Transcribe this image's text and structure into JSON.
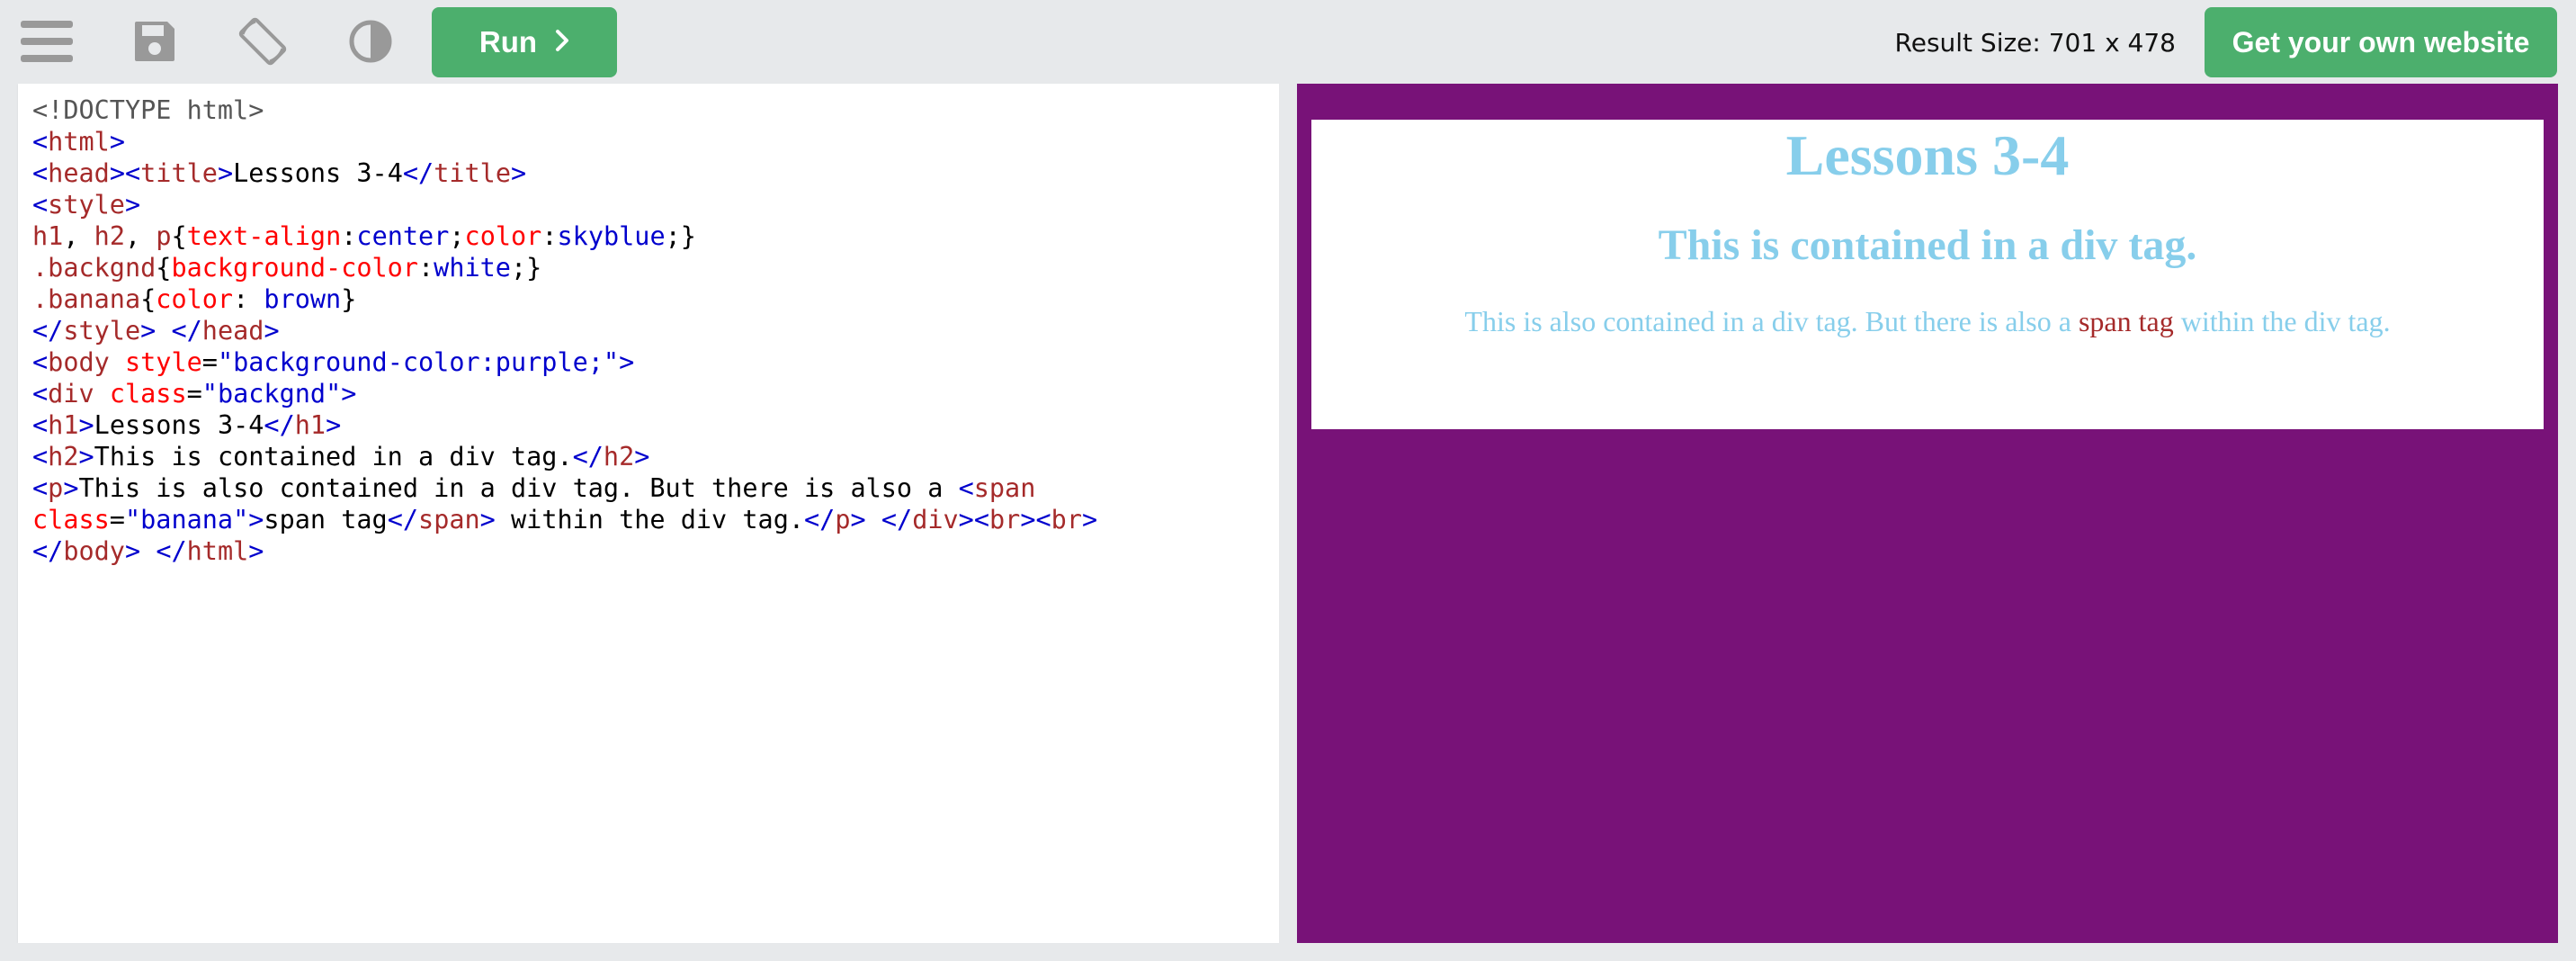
{
  "toolbar": {
    "icons": {
      "menu": "hamburger-menu-icon",
      "save": "save-floppy-icon",
      "rotate": "rotate-orientation-icon",
      "theme": "contrast-theme-icon"
    },
    "run_label": "Run",
    "result_size": "Result Size: 701 x 478",
    "own_website_label": "Get your own website"
  },
  "colors": {
    "accent_green": "#4caf6d",
    "toolbar_bg": "#e7e9eb",
    "result_bg": "#781278"
  },
  "editor": {
    "lines": [
      [
        {
          "t": "doc",
          "v": "<!DOCTYPE html>"
        }
      ],
      [
        {
          "t": "br",
          "v": "<"
        },
        {
          "t": "tag",
          "v": "html"
        },
        {
          "t": "br",
          "v": ">"
        }
      ],
      [
        {
          "t": "br",
          "v": "<"
        },
        {
          "t": "tag",
          "v": "head"
        },
        {
          "t": "br",
          "v": "><"
        },
        {
          "t": "tag",
          "v": "title"
        },
        {
          "t": "br",
          "v": ">"
        },
        {
          "t": "txt",
          "v": "Lessons 3-4"
        },
        {
          "t": "br",
          "v": "</"
        },
        {
          "t": "tag",
          "v": "title"
        },
        {
          "t": "br",
          "v": ">"
        }
      ],
      [
        {
          "t": "br",
          "v": "<"
        },
        {
          "t": "tag",
          "v": "style"
        },
        {
          "t": "br",
          "v": ">"
        }
      ],
      [
        {
          "t": "sel",
          "v": "h1"
        },
        {
          "t": "txt",
          "v": ", "
        },
        {
          "t": "sel",
          "v": "h2"
        },
        {
          "t": "txt",
          "v": ", "
        },
        {
          "t": "sel",
          "v": "p"
        },
        {
          "t": "txt",
          "v": "{"
        },
        {
          "t": "css",
          "v": "text-align"
        },
        {
          "t": "txt",
          "v": ":"
        },
        {
          "t": "val",
          "v": "center"
        },
        {
          "t": "txt",
          "v": ";"
        },
        {
          "t": "css",
          "v": "color"
        },
        {
          "t": "txt",
          "v": ":"
        },
        {
          "t": "val",
          "v": "skyblue"
        },
        {
          "t": "txt",
          "v": ";}"
        }
      ],
      [
        {
          "t": "sel",
          "v": ".backgnd"
        },
        {
          "t": "txt",
          "v": "{"
        },
        {
          "t": "css",
          "v": "background-color"
        },
        {
          "t": "txt",
          "v": ":"
        },
        {
          "t": "val",
          "v": "white"
        },
        {
          "t": "txt",
          "v": ";}"
        }
      ],
      [
        {
          "t": "sel",
          "v": ".banana"
        },
        {
          "t": "txt",
          "v": "{"
        },
        {
          "t": "css",
          "v": "color"
        },
        {
          "t": "txt",
          "v": ": "
        },
        {
          "t": "val",
          "v": "brown"
        },
        {
          "t": "txt",
          "v": "}"
        }
      ],
      [
        {
          "t": "br",
          "v": "</"
        },
        {
          "t": "tag",
          "v": "style"
        },
        {
          "t": "br",
          "v": ">"
        },
        {
          "t": "txt",
          "v": " "
        },
        {
          "t": "br",
          "v": "</"
        },
        {
          "t": "tag",
          "v": "head"
        },
        {
          "t": "br",
          "v": ">"
        }
      ],
      [
        {
          "t": "br",
          "v": "<"
        },
        {
          "t": "tag",
          "v": "body"
        },
        {
          "t": "txt",
          "v": " "
        },
        {
          "t": "attr",
          "v": "style"
        },
        {
          "t": "txt",
          "v": "="
        },
        {
          "t": "val",
          "v": "\"background-color:purple;\""
        },
        {
          "t": "br",
          "v": ">"
        }
      ],
      [
        {
          "t": "br",
          "v": "<"
        },
        {
          "t": "tag",
          "v": "div"
        },
        {
          "t": "txt",
          "v": " "
        },
        {
          "t": "attr",
          "v": "class"
        },
        {
          "t": "txt",
          "v": "="
        },
        {
          "t": "val",
          "v": "\"backgnd\""
        },
        {
          "t": "br",
          "v": ">"
        }
      ],
      [
        {
          "t": "br",
          "v": "<"
        },
        {
          "t": "tag",
          "v": "h1"
        },
        {
          "t": "br",
          "v": ">"
        },
        {
          "t": "txt",
          "v": "Lessons 3-4"
        },
        {
          "t": "br",
          "v": "</"
        },
        {
          "t": "tag",
          "v": "h1"
        },
        {
          "t": "br",
          "v": ">"
        }
      ],
      [
        {
          "t": "br",
          "v": "<"
        },
        {
          "t": "tag",
          "v": "h2"
        },
        {
          "t": "br",
          "v": ">"
        },
        {
          "t": "txt",
          "v": "This is contained in a div tag."
        },
        {
          "t": "br",
          "v": "</"
        },
        {
          "t": "tag",
          "v": "h2"
        },
        {
          "t": "br",
          "v": ">"
        }
      ],
      [
        {
          "t": "br",
          "v": "<"
        },
        {
          "t": "tag",
          "v": "p"
        },
        {
          "t": "br",
          "v": ">"
        },
        {
          "t": "txt",
          "v": "This is also contained in a div tag. But there is also a "
        },
        {
          "t": "br",
          "v": "<"
        },
        {
          "t": "tag",
          "v": "span"
        }
      ],
      [
        {
          "t": "attr",
          "v": "class"
        },
        {
          "t": "txt",
          "v": "="
        },
        {
          "t": "val",
          "v": "\"banana\""
        },
        {
          "t": "br",
          "v": ">"
        },
        {
          "t": "txt",
          "v": "span tag"
        },
        {
          "t": "br",
          "v": "</"
        },
        {
          "t": "tag",
          "v": "span"
        },
        {
          "t": "br",
          "v": ">"
        },
        {
          "t": "txt",
          "v": " within the div tag."
        },
        {
          "t": "br",
          "v": "</"
        },
        {
          "t": "tag",
          "v": "p"
        },
        {
          "t": "br",
          "v": ">"
        },
        {
          "t": "txt",
          "v": " "
        },
        {
          "t": "br",
          "v": "</"
        },
        {
          "t": "tag",
          "v": "div"
        },
        {
          "t": "br",
          "v": "><"
        },
        {
          "t": "tag",
          "v": "br"
        },
        {
          "t": "br",
          "v": "><"
        },
        {
          "t": "tag",
          "v": "br"
        },
        {
          "t": "br",
          "v": ">"
        }
      ],
      [
        {
          "t": "br",
          "v": "</"
        },
        {
          "t": "tag",
          "v": "body"
        },
        {
          "t": "br",
          "v": ">"
        },
        {
          "t": "txt",
          "v": " "
        },
        {
          "t": "br",
          "v": "</"
        },
        {
          "t": "tag",
          "v": "html"
        },
        {
          "t": "br",
          "v": ">"
        }
      ]
    ]
  },
  "result": {
    "h1": "Lessons 3-4",
    "h2": "This is contained in a div tag.",
    "p_before": "This is also contained in a div tag. But there is also a ",
    "p_span": "span tag",
    "p_after": " within the div tag."
  }
}
